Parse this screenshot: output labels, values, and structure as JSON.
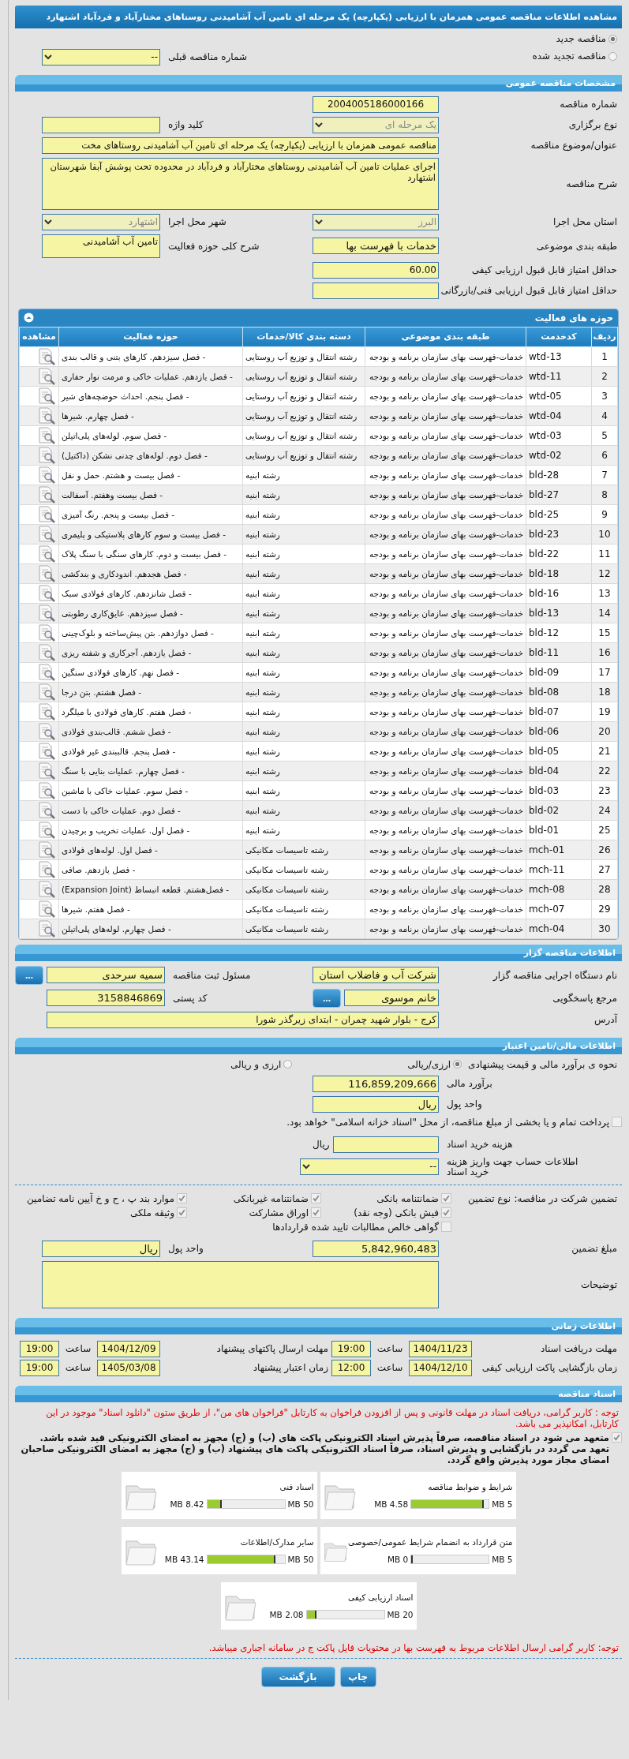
{
  "title": "مشاهده اطلاعات مناقصه عمومی همزمان با ارزیابی (یکپارچه) یک مرحله ای تامین آب آشامیدنی روستاهای مختارآباد و فردآباد اشتهارد",
  "tender_type": [
    {
      "label": "مناقصه جدید",
      "selected": true
    },
    {
      "label": "مناقصه تجدید شده",
      "selected": false
    }
  ],
  "previous_number": {
    "label": "شماره مناقصه قبلی",
    "value": "--"
  },
  "general": {
    "header": "مشخصات مناقصه عمومی",
    "number": {
      "label": "شماره مناقصه",
      "value": "2004005186000166"
    },
    "holding_type": {
      "label": "نوع برگزاری",
      "value": "یک مرحله ای"
    },
    "keyword": {
      "label": "کلید واژه"
    },
    "subject": {
      "label": "عنوان/موضوع مناقصه",
      "value": "مناقصه عمومی همزمان با ارزیابی (یکپارچه) یک مرحله ای تامین آب آشامیدنی روستاهای مخت"
    },
    "description": {
      "label": "شرح مناقصه",
      "value": "اجرای عملیات تامین آب آشامیدنی روستاهای مختارآباد و فردآباد در محدوده تحت پوشش آبفا شهرستان اشتهارد"
    },
    "province": {
      "label": "استان محل اجرا",
      "value": "البرز"
    },
    "city": {
      "label": "شهر محل اجرا",
      "value": "اشتهارد"
    },
    "classification": {
      "label": "طبقه بندی موضوعی",
      "value": "خدمات با فهرست بها"
    },
    "activity_scope": {
      "label": "شرح کلی حوزه فعالیت",
      "value": "تامین آب آشامیدنی"
    },
    "min_quality_score": {
      "label": "حداقل امتیاز قابل قبول ارزیابی کیفی",
      "value": "60.00"
    },
    "min_tech_score": {
      "label": "حداقل امتیاز قابل قبول ارزیابی فنی/بازرگانی"
    }
  },
  "activities": {
    "header": "حوزه های فعالیت",
    "columns": [
      "ردیف",
      "کدخدمت",
      "طبقه بندی موضوعی",
      "دسته بندی کالا/خدمات",
      "حوزه فعالیت",
      "مشاهده"
    ],
    "rows": [
      {
        "no": "1",
        "code": "wtd-13",
        "category": "خدمات-فهرست بهای سازمان برنامه و بودجه",
        "group": "رشته انتقال و توزیع آب روستایی",
        "activity": "- فصل سیزدهم. کارهای بتنی و قالب بندی"
      },
      {
        "no": "2",
        "code": "wtd-11",
        "category": "خدمات-فهرست بهای سازمان برنامه و بودجه",
        "group": "رشته انتقال و توزیع آب روستایی",
        "activity": "- فصل یازدهم. عملیات خاکی و مرمت نوار حفاری"
      },
      {
        "no": "3",
        "code": "wtd-05",
        "category": "خدمات-فهرست بهای سازمان برنامه و بودجه",
        "group": "رشته انتقال و توزیع آب روستایی",
        "activity": "- فصل پنجم. احداث حوضچه‌های شیر"
      },
      {
        "no": "4",
        "code": "wtd-04",
        "category": "خدمات-فهرست بهای سازمان برنامه و بودجه",
        "group": "رشته انتقال و توزیع آب روستایی",
        "activity": "- فصل چهارم. شیرها"
      },
      {
        "no": "5",
        "code": "wtd-03",
        "category": "خدمات-فهرست بهای سازمان برنامه و بودجه",
        "group": "رشته انتقال و توزیع آب روستایی",
        "activity": "- فصل سوم. لوله‌های پلی‌اتیلن"
      },
      {
        "no": "6",
        "code": "wtd-02",
        "category": "خدمات-فهرست بهای سازمان برنامه و بودجه",
        "group": "رشته انتقال و توزیع آب روستایی",
        "activity": "- فصل دوم. لوله‌های چدنی نشکن (داکتیل)"
      },
      {
        "no": "7",
        "code": "bld-28",
        "category": "خدمات-فهرست بهای سازمان برنامه و بودجه",
        "group": "رشته ابنیه",
        "activity": "- فصل بیست و هشتم. حمل و نقل"
      },
      {
        "no": "8",
        "code": "bld-27",
        "category": "خدمات-فهرست بهای سازمان برنامه و بودجه",
        "group": "رشته ابنیه",
        "activity": "- فصل بیست وهفتم. آسفالت"
      },
      {
        "no": "9",
        "code": "bld-25",
        "category": "خدمات-فهرست بهای سازمان برنامه و بودجه",
        "group": "رشته ابنیه",
        "activity": "- فصل بیست و پنجم. رنگ آمیزی"
      },
      {
        "no": "10",
        "code": "bld-23",
        "category": "خدمات-فهرست بهای سازمان برنامه و بودجه",
        "group": "رشته ابنیه",
        "activity": "- فصل بیست و سوم کارهای پلاستیکی و پلیمری"
      },
      {
        "no": "11",
        "code": "bld-22",
        "category": "خدمات-فهرست بهای سازمان برنامه و بودجه",
        "group": "رشته ابنیه",
        "activity": "- فصل بیست و دوم. کارهای سنگی با سنگ پلاک"
      },
      {
        "no": "12",
        "code": "bld-18",
        "category": "خدمات-فهرست بهای سازمان برنامه و بودجه",
        "group": "رشته ابنیه",
        "activity": "- فصل هجدهم. اندودکاری و بندکشی"
      },
      {
        "no": "13",
        "code": "bld-16",
        "category": "خدمات-فهرست بهای سازمان برنامه و بودجه",
        "group": "رشته ابنیه",
        "activity": "- فصل شانزدهم. کارهای فولادی سبک"
      },
      {
        "no": "14",
        "code": "bld-13",
        "category": "خدمات-فهرست بهای سازمان برنامه و بودجه",
        "group": "رشته ابنیه",
        "activity": "- فصل سیزدهم. عایق‌کاری رطوبتی"
      },
      {
        "no": "15",
        "code": "bld-12",
        "category": "خدمات-فهرست بهای سازمان برنامه و بودجه",
        "group": "رشته ابنیه",
        "activity": "- فصل دوازدهم. بتن پیش‌ساخته و بلوک‌چینی"
      },
      {
        "no": "16",
        "code": "bld-11",
        "category": "خدمات-فهرست بهای سازمان برنامه و بودجه",
        "group": "رشته ابنیه",
        "activity": "- فصل یازدهم. آجرکاری و شفته ریزی"
      },
      {
        "no": "17",
        "code": "bld-09",
        "category": "خدمات-فهرست بهای سازمان برنامه و بودجه",
        "group": "رشته ابنیه",
        "activity": "- فصل نهم. کارهای فولادی سنگین"
      },
      {
        "no": "18",
        "code": "bld-08",
        "category": "خدمات-فهرست بهای سازمان برنامه و بودجه",
        "group": "رشته ابنیه",
        "activity": "- فصل هشتم. بتن درجا"
      },
      {
        "no": "19",
        "code": "bld-07",
        "category": "خدمات-فهرست بهای سازمان برنامه و بودجه",
        "group": "رشته ابنیه",
        "activity": "- فصل هفتم. کارهای فولادی با میلگرد"
      },
      {
        "no": "20",
        "code": "bld-06",
        "category": "خدمات-فهرست بهای سازمان برنامه و بودجه",
        "group": "رشته ابنیه",
        "activity": "- فصل ششم. قالب‌بندی فولادی"
      },
      {
        "no": "21",
        "code": "bld-05",
        "category": "خدمات-فهرست بهای سازمان برنامه و بودجه",
        "group": "رشته ابنیه",
        "activity": "- فصل پنجم. قالببندی غیر فولادی"
      },
      {
        "no": "22",
        "code": "bld-04",
        "category": "خدمات-فهرست بهای سازمان برنامه و بودجه",
        "group": "رشته ابنیه",
        "activity": "- فصل چهارم. عملیات بنایی با سنگ"
      },
      {
        "no": "23",
        "code": "bld-03",
        "category": "خدمات-فهرست بهای سازمان برنامه و بودجه",
        "group": "رشته ابنیه",
        "activity": "- فصل سوم. عملیات خاکی با ماشین"
      },
      {
        "no": "24",
        "code": "bld-02",
        "category": "خدمات-فهرست بهای سازمان برنامه و بودجه",
        "group": "رشته ابنیه",
        "activity": "- فصل دوم. عملیات خاکی با دست"
      },
      {
        "no": "25",
        "code": "bld-01",
        "category": "خدمات-فهرست بهای سازمان برنامه و بودجه",
        "group": "رشته ابنیه",
        "activity": "- فصل اول. عملیات تخریب و برچیدن"
      },
      {
        "no": "26",
        "code": "mch-01",
        "category": "خدمات-فهرست بهای سازمان برنامه و بودجه",
        "group": "رشته تاسیسات مکانیکی",
        "activity": "- فصل اول. لوله‌های فولادی"
      },
      {
        "no": "27",
        "code": "mch-11",
        "category": "خدمات-فهرست بهای سازمان برنامه و بودجه",
        "group": "رشته تاسیسات مکانیکی",
        "activity": "- فصل یازدهم. صافی"
      },
      {
        "no": "28",
        "code": "mch-08",
        "category": "خدمات-فهرست بهای سازمان برنامه و بودجه",
        "group": "رشته تاسیسات مکانیکی",
        "activity": "- فصل‌هشتم. قطعه انبساط (Expansion Joint)"
      },
      {
        "no": "29",
        "code": "mch-07",
        "category": "خدمات-فهرست بهای سازمان برنامه و بودجه",
        "group": "رشته تاسیسات مکانیکی",
        "activity": "- فصل هفتم. شیرها"
      },
      {
        "no": "30",
        "code": "mch-04",
        "category": "خدمات-فهرست بهای سازمان برنامه و بودجه",
        "group": "رشته تاسیسات مکانیکی",
        "activity": "- فصل چهارم. لوله‌های پلی‌اتیلن"
      }
    ]
  },
  "tenderer": {
    "header": "اطلاعات مناقصه گزار",
    "organization": {
      "label": "نام دستگاه اجرایی مناقصه گزار",
      "value": "شرکت آب و فاضلاب استان"
    },
    "registrar": {
      "label": "مسئول ثبت مناقصه",
      "value": "سمیه سرحدی",
      "button": "..."
    },
    "contact": {
      "label": "مرجع پاسخگویی",
      "value": "خانم موسوی",
      "button": "..."
    },
    "postal_code": {
      "label": "کد پستی",
      "value": "3158846869"
    },
    "address": {
      "label": "آدرس",
      "value": "کرج - بلوار شهید چمران - ابتدای زیرگذر شورا"
    }
  },
  "financial": {
    "header": "اطلاعات مالی/تامین اعتبار",
    "method_label": "نحوه ی برآورد مالی و قیمت پیشنهادی",
    "methods": [
      {
        "label": "ارزی/ریالی",
        "selected": true
      },
      {
        "label": "ارزی و ریالی",
        "selected": false
      }
    ],
    "estimate": {
      "label": "برآورد مالی",
      "value": "116,859,209,666"
    },
    "currency": {
      "label": "واحد پول",
      "value": "ریال"
    },
    "treasury": {
      "checked": false,
      "text": "پرداخت تمام و یا بخشی از مبلغ مناقصه، از محل \"اسناد خزانه اسلامی\" خواهد بود."
    },
    "document_fee": {
      "label": "هزینه خرید اسناد",
      "unit": "ریال"
    },
    "account": {
      "label": "اطلاعات حساب جهت واریز هزینه خرید اسناد",
      "value": "--"
    }
  },
  "guarantee": {
    "label": "تضمین شرکت در مناقصه:",
    "type_label": "نوع تضمین",
    "options": [
      {
        "label": "ضمانتنامه بانکی",
        "checked": true
      },
      {
        "label": "ضمانتنامه غیربانکی",
        "checked": true
      },
      {
        "label": "موارد بند پ ، ح و خ آیین نامه تضامین",
        "checked": true
      },
      {
        "label": "فیش بانکی (وجه نقد)",
        "checked": true
      },
      {
        "label": "اوراق مشارکت",
        "checked": true
      },
      {
        "label": "وثیقه ملکی",
        "checked": true
      },
      {
        "label": "گواهی خالص مطالبات تایید شده قراردادها",
        "checked": false
      }
    ],
    "amount": {
      "label": "مبلغ تضمین",
      "value": "5,842,960,483"
    },
    "currency": {
      "label": "واحد پول",
      "value": "ریال"
    },
    "notes": {
      "label": "توضیحات"
    }
  },
  "timing": {
    "header": "اطلاعات زمانی",
    "rows": [
      {
        "label": "مهلت دریافت اسناد",
        "date": "1404/11/23",
        "time_label": "ساعت",
        "time": "19:00"
      },
      {
        "label": "مهلت ارسال پاکتهای پیشنهاد",
        "date": "1404/12/09",
        "time_label": "ساعت",
        "time": "19:00"
      },
      {
        "label": "زمان بازگشایی پاکت ارزیابی کیفی",
        "date": "1404/12/10",
        "time_label": "ساعت",
        "time": "12:00"
      },
      {
        "label": "زمان اعتبار پیشنهاد",
        "date": "1405/03/08",
        "time_label": "ساعت",
        "time": "19:00"
      }
    ]
  },
  "documents": {
    "header": "اسناد مناقصه",
    "note": "توجه : کاربر گرامی، دریافت اسناد در مهلت قانونی و پس از افزودن فراخوان به کارتابل \"فراخوان های من\"، از طریق ستون \"دانلود اسناد\" موجود در این کارتابل، امکانپذیر می باشد.",
    "commitment": {
      "checked": true,
      "text": "متعهد می شود در اسناد مناقصه، صرفاً پذیرش اسناد الکترونیکی پاکت های (ب) و (ج) مجهز به امضای الکترونیکی قید شده باشد. تعهد می گردد در بازگشایی و پذیرش اسناد، صرفاً اسناد الکترونیکی پاکت های پیشنهاد (ب) و (ج) مجهز به امضای الکترونیکی صاحبان امضای مجاز مورد پذیرش واقع گردد."
    },
    "files": [
      {
        "title": "شرایط و ضوابط مناقصه",
        "max": "5 MB",
        "used": "4.58 MB",
        "level": 0.916
      },
      {
        "title": "اسناد فنی",
        "max": "50 MB",
        "used": "8.42 MB",
        "level": 0.168
      },
      {
        "title": "متن قرارداد به انضمام شرایط عمومی/خصوصی",
        "max": "5 MB",
        "used": "0 MB",
        "level": 0
      },
      {
        "title": "سایر مدارک/اطلاعات",
        "max": "50 MB",
        "used": "43.14 MB",
        "level": 0.863
      },
      {
        "title": "اسناد ارزیابی کیفی",
        "max": "20 MB",
        "used": "2.08 MB",
        "level": 0.104
      }
    ],
    "footer_note": "توجه: کاربر گرامی ارسال اطلاعات مربوط به فهرست بها در محتویات فایل پاکت ج در سامانه اجباری میباشد.",
    "buttons": [
      "چاپ",
      "بازگشت"
    ]
  }
}
